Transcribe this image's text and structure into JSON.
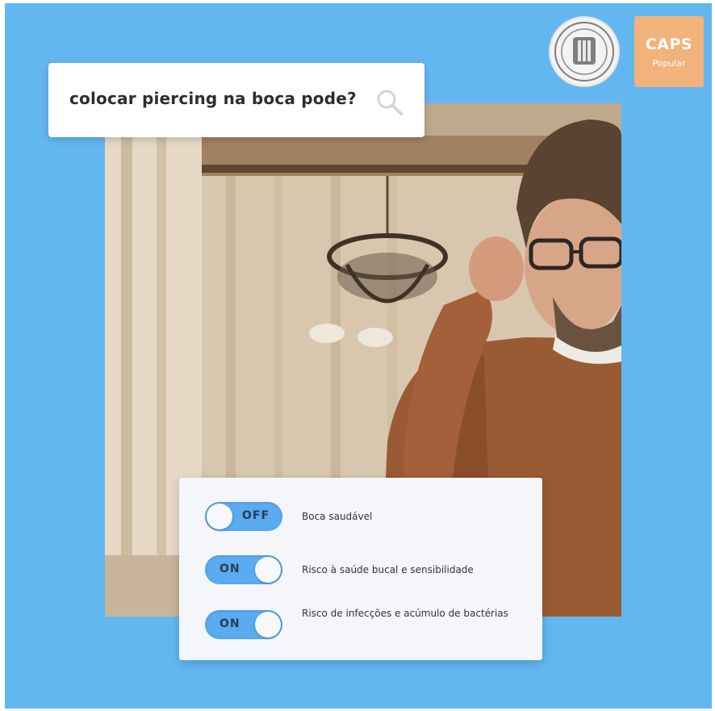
{
  "search": {
    "query": "colocar piercing na boca pode?",
    "icon": "magnifier-icon"
  },
  "logos": {
    "seal_icon": "university-seal-icon",
    "caps_title": "CAPS",
    "caps_subtitle": "Popular"
  },
  "toggles": [
    {
      "state": "OFF",
      "label": "Boca saudável"
    },
    {
      "state": "ON",
      "label": "Risco à saúde bucal e sensibilidade"
    },
    {
      "state": "ON",
      "label": "Risco de infecções e acúmulo de bactérias"
    }
  ],
  "colors": {
    "background": "#63b7f1",
    "switch": "#5aabf0",
    "card": "#f4f6fa",
    "caps_logo": "#f2b27c"
  }
}
